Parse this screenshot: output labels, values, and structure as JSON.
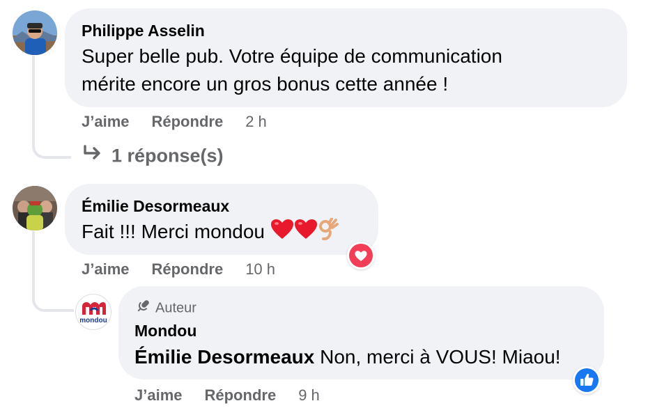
{
  "comments": [
    {
      "author": "Philippe Asselin",
      "text_line1": "Super belle pub. Votre équipe de communication",
      "text_line2": "mérite encore un gros bonus cette année !",
      "like_label": "J’aime",
      "reply_label": "Répondre",
      "time": "2 h",
      "replies_label": "1 réponse(s)"
    },
    {
      "author": "Émilie Desormeaux",
      "text": "Fait !!! Merci mondou",
      "emojis": [
        "red-heart",
        "red-heart",
        "ok-hand"
      ],
      "reaction": "love-reaction",
      "like_label": "J’aime",
      "reply_label": "Répondre",
      "time": "10 h"
    }
  ],
  "reply": {
    "badge_label": "Auteur",
    "badge_icon": "microphone-icon",
    "author": "Mondou",
    "mention": "Émilie Desormeaux",
    "text": " Non, merci à VOUS! Miaou!",
    "reaction": "like-reaction",
    "like_label": "J’aime",
    "reply_label": "Répondre",
    "time": "9 h",
    "avatar_logo_text": "mondou"
  },
  "colors": {
    "bubble": "#f0f2f5",
    "secondary_text": "#65676b",
    "love": "#f33e58",
    "like": "#1877f2",
    "mondou_red": "#d6243a",
    "mondou_blue": "#1b3a8c"
  }
}
